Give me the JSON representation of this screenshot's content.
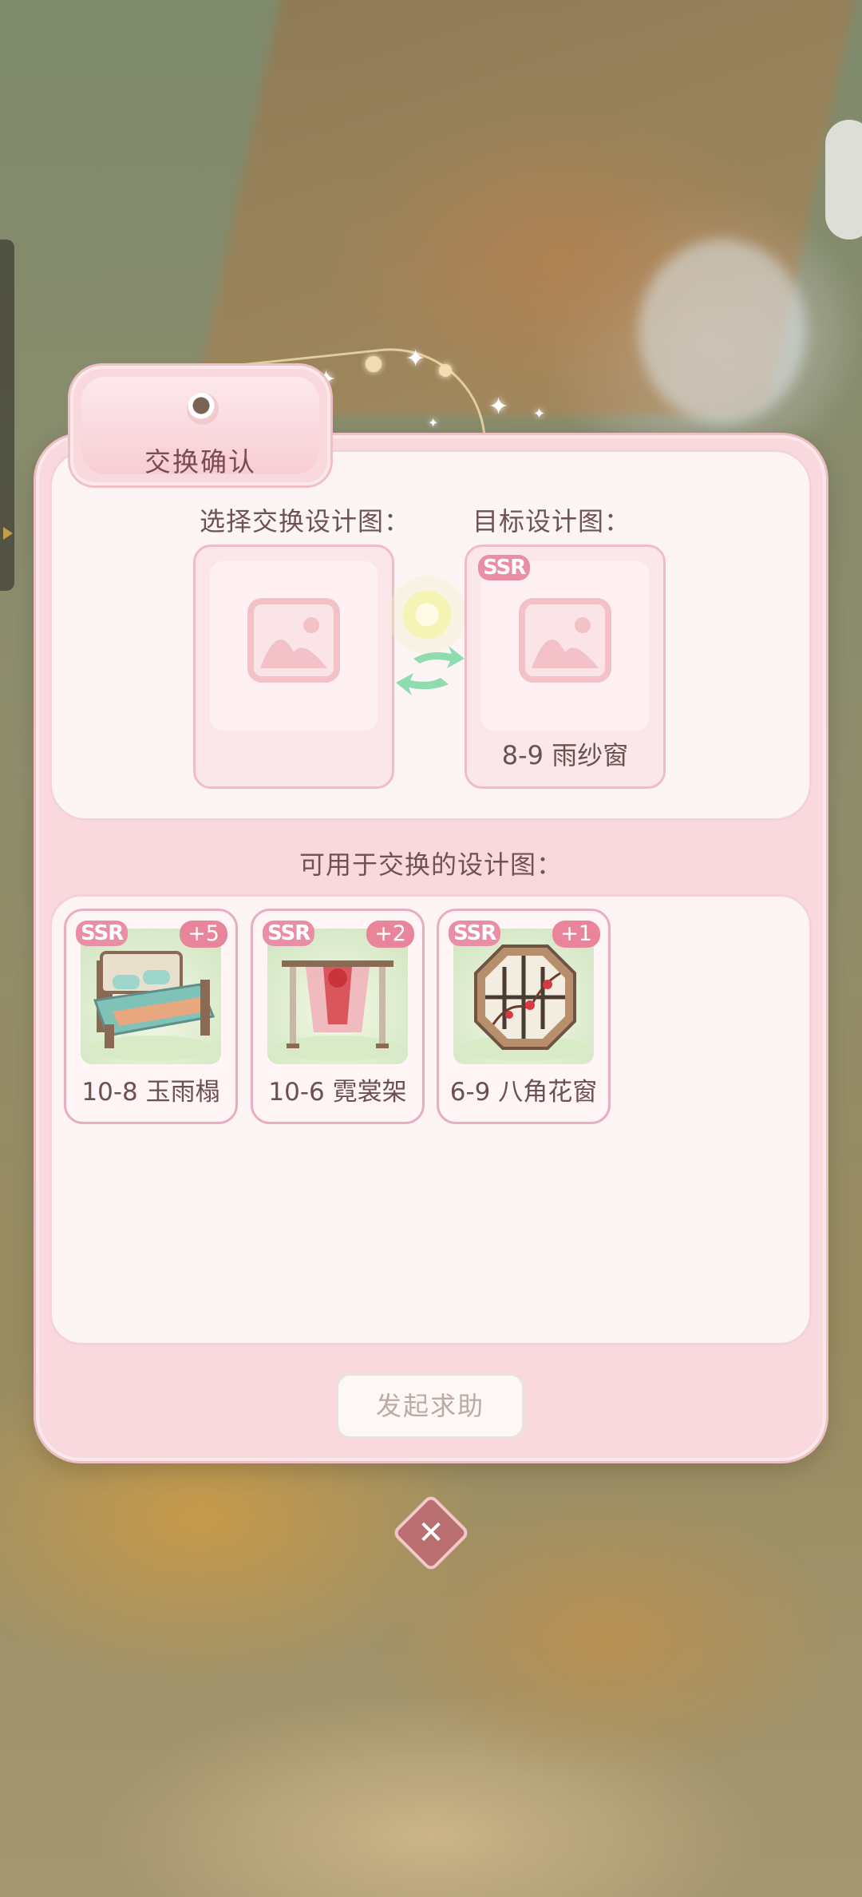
{
  "dialog": {
    "title": "交换确认",
    "select_label": "选择交换设计图：",
    "target_label": "目标设计图：",
    "target": {
      "rarity": "SSR",
      "name": "8-9 雨纱窗"
    },
    "available_label": "可用于交换的设计图：",
    "items": [
      {
        "rarity": "SSR",
        "count": "+5",
        "name": "10-8 玉雨榻",
        "icon": "bed-icon"
      },
      {
        "rarity": "SSR",
        "count": "+2",
        "name": "10-6 霓裳架",
        "icon": "clothes-rack-icon"
      },
      {
        "rarity": "SSR",
        "count": "+1",
        "name": "6-9 八角花窗",
        "icon": "octagon-window-icon"
      }
    ],
    "help_button": "发起求助"
  },
  "colors": {
    "panel_pink": "#f9d9dd",
    "ssr_badge": "#ea8ea6",
    "count_badge": "#e9859a",
    "close_button": "#b96f70"
  }
}
